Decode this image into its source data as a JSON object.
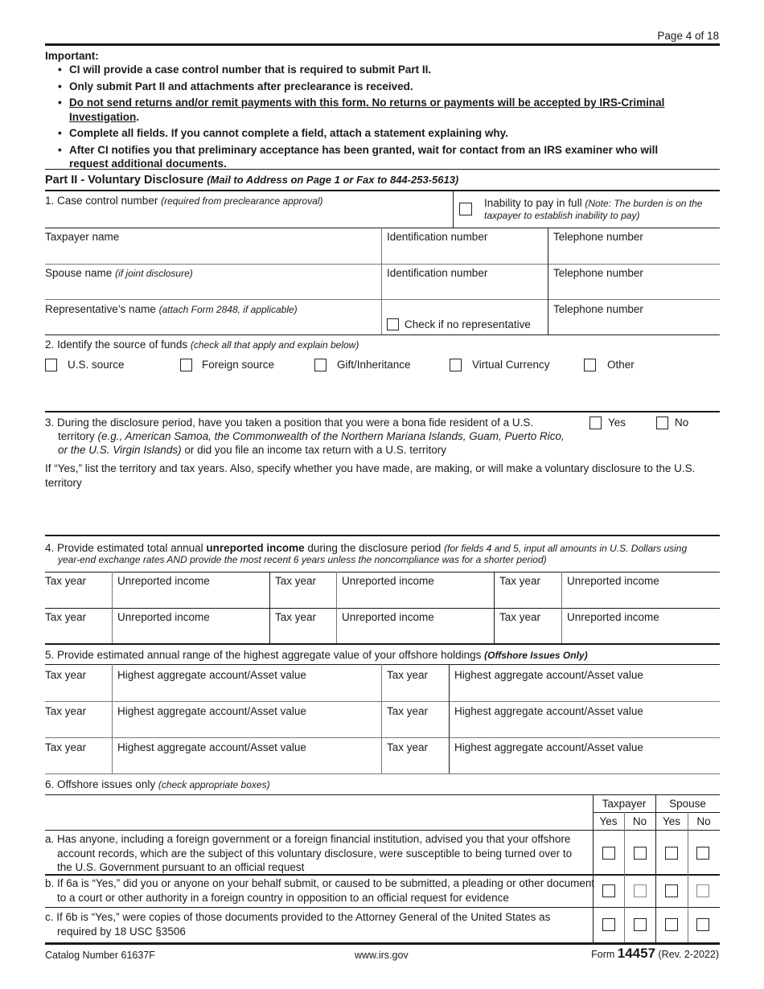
{
  "header": {
    "page_label": "Page 4 of 18"
  },
  "important": {
    "title": "Important:",
    "bullets": [
      "CI will provide a case control number that is required to submit Part II.",
      "Only submit Part II and attachments after preclearance is received.",
      "Do not send returns and/or remit payments with this form. No returns or payments will be accepted by IRS-Criminal Investigation",
      "Complete all fields. If you cannot complete a field, attach a statement explaining why.",
      "After CI notifies you that preliminary acceptance has been granted, wait for contact from an IRS examiner who will request additional documents."
    ]
  },
  "part2": {
    "title": "Part II - Voluntary Disclosure",
    "subtitle": "(Mail to Address on Page 1 or Fax to 844-253-5613)"
  },
  "q1": {
    "label": "1. Case control number",
    "note": "(required from preclearance approval)",
    "inability_label": "Inability to pay in full",
    "inability_note_1": "(Note: The burden is on the",
    "inability_note_2": "taxpayer to establish inability to pay)",
    "inability_checked": false,
    "taxpayer_name": "Taxpayer name",
    "spouse_name": "Spouse name",
    "spouse_note": "(if joint disclosure)",
    "rep_name": "Representative’s name",
    "rep_note": "(attach Form 2848, if applicable)",
    "id_number": "Identification number",
    "telephone": "Telephone number",
    "no_rep_label": "Check if no representative",
    "no_rep_checked": false
  },
  "q2": {
    "label": "2. Identify the source of funds",
    "note": "(check all that apply and explain below)",
    "options": [
      {
        "label": "U.S. source",
        "checked": false
      },
      {
        "label": "Foreign source",
        "checked": false
      },
      {
        "label": "Gift/Inheritance",
        "checked": false
      },
      {
        "label": "Virtual Currency",
        "checked": false
      },
      {
        "label": "Other",
        "checked": false
      }
    ]
  },
  "q3": {
    "line1": "3. During the disclosure period, have you taken a position that you were a bona fide resident of a U.S.",
    "line2_a": "territory ",
    "line2_b": "(e.g., American Samoa, the Commonwealth of the Northern Mariana Islands, Guam, Puerto Rico,",
    "line3_a": "or the U.S. Virgin Islands)",
    "line3_b": " or did you file an income tax return with a U.S. territory",
    "yes": "Yes",
    "no": "No",
    "followup": "If “Yes,” list the territory and tax years. Also, specify whether you have made, are making, or will make a voluntary disclosure to the U.S. territory"
  },
  "q4": {
    "label_a": "4. Provide estimated total annual ",
    "label_b": "unreported income",
    "label_c": " during the disclosure period ",
    "note_1": "(for fields 4 and 5, input all amounts in U.S. Dollars using",
    "note_2": "year-end exchange rates AND provide the most recent 6 years unless the noncompliance was for a shorter period)",
    "tax_year": "Tax year",
    "unreported": "Unreported income"
  },
  "q5": {
    "label": "5. Provide estimated annual range of the highest aggregate value of your offshore holdings ",
    "note": "(Offshore Issues Only)",
    "tax_year": "Tax year",
    "asset_value": "Highest aggregate account/Asset value"
  },
  "q6": {
    "label": "6. Offshore issues only ",
    "note": "(check appropriate boxes)",
    "taxpayer": "Taxpayer",
    "spouse": "Spouse",
    "yes": "Yes",
    "no": "No",
    "rows": [
      {
        "text": "a. Has anyone, including a foreign government or a foreign financial institution, advised you that your offshore account records, which are the subject of this voluntary disclosure, were susceptible to being turned over to the U.S. Government pursuant to an official request"
      },
      {
        "text": "b. If 6a is “Yes,” did you or anyone on your behalf submit, or caused to be submitted, a pleading or other document to a court or other authority in a foreign country in opposition to an official request for evidence"
      },
      {
        "text": "c. If 6b is “Yes,” were copies of those documents provided to the Attorney General of the United States as required by 18 USC §3506"
      }
    ]
  },
  "footer": {
    "catalog": "Catalog Number 61637F",
    "website": "www.irs.gov",
    "form_prefix": "Form ",
    "form_number": "14457",
    "form_rev": " (Rev. 2-2022)"
  }
}
